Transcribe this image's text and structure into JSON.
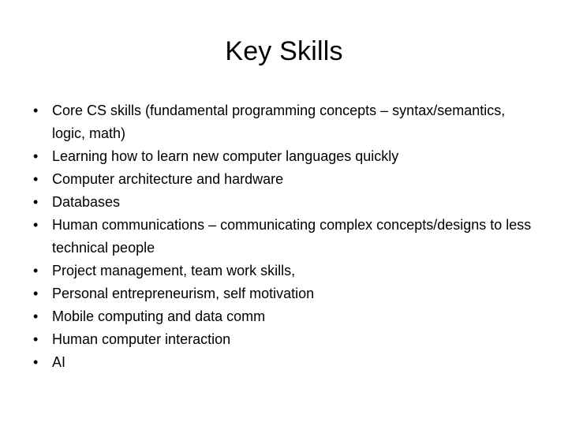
{
  "slide": {
    "title": "Key Skills",
    "background_color": "#ffffff",
    "text_color": "#000000",
    "bullet_glyph": "•",
    "bullets": [
      {
        "text": "Core CS skills (fundamental programming concepts – syntax/semantics, logic, math)"
      },
      {
        "text": "Learning how to learn new computer languages quickly"
      },
      {
        "text": "Computer architecture and hardware"
      },
      {
        "text": "Databases"
      },
      {
        "text": "Human communications – communicating complex concepts/designs to less technical people"
      },
      {
        "text": "Project management, team work skills,"
      },
      {
        "text": "Personal entrepreneurism, self motivation"
      },
      {
        "text": "Mobile computing and data comm"
      },
      {
        "text": "Human computer interaction"
      },
      {
        "text": "AI"
      }
    ]
  }
}
